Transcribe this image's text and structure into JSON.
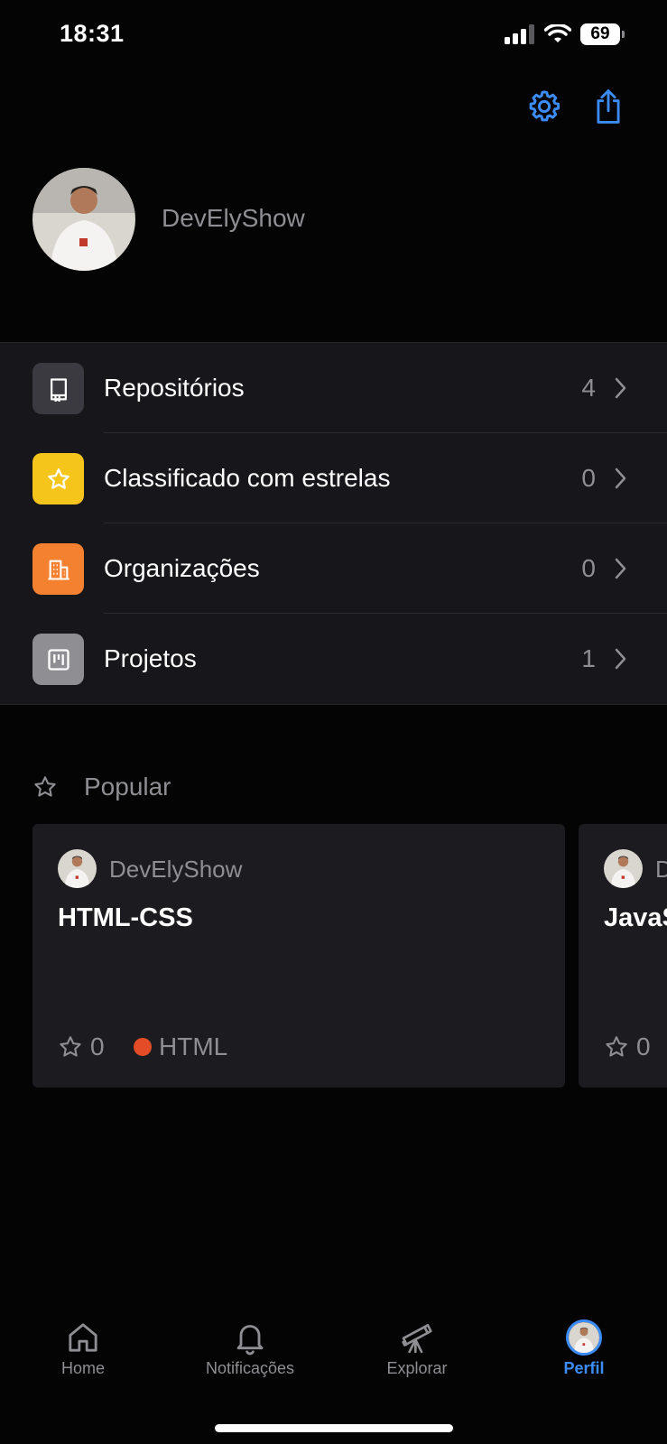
{
  "status": {
    "time": "18:31",
    "battery": "69"
  },
  "profile": {
    "username": "DevElyShow"
  },
  "menu": [
    {
      "label": "Repositórios",
      "count": "4",
      "icon": "repo-icon",
      "color": "#3a3a40"
    },
    {
      "label": "Classificado com estrelas",
      "count": "0",
      "icon": "star-icon",
      "color": "#f5c51b"
    },
    {
      "label": "Organizações",
      "count": "0",
      "icon": "organization-icon",
      "color": "#f4812f"
    },
    {
      "label": "Projetos",
      "count": "1",
      "icon": "project-icon",
      "color": "#8e8e93"
    }
  ],
  "popular": {
    "title": "Popular",
    "cards": [
      {
        "owner": "DevElyShow",
        "name": "HTML-CSS",
        "stars": "0",
        "language": "HTML",
        "language_color": "#e34c26"
      },
      {
        "owner": "DevElyShow",
        "name": "JavaScript",
        "stars": "0",
        "language": "",
        "language_color": ""
      }
    ]
  },
  "tabs": [
    {
      "label": "Home",
      "icon": "home-icon"
    },
    {
      "label": "Notificações",
      "icon": "bell-icon"
    },
    {
      "label": "Explorar",
      "icon": "telescope-icon"
    },
    {
      "label": "Perfil",
      "icon": "avatar",
      "active": true
    }
  ],
  "colors": {
    "accent": "#3b8cf6",
    "background": "#040405",
    "surface": "#17171b"
  }
}
